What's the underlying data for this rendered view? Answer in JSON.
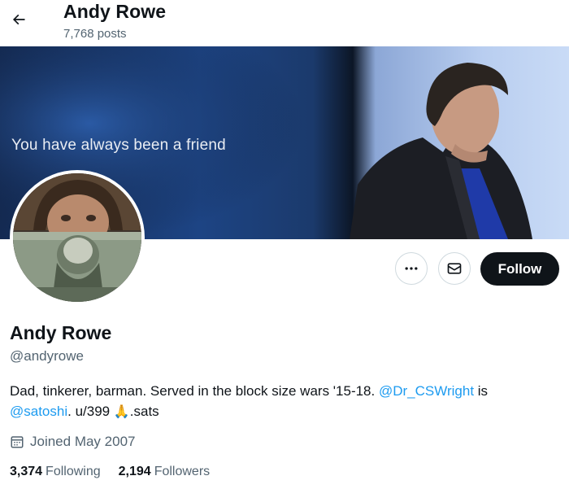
{
  "header": {
    "name": "Andy Rowe",
    "posts": "7,768 posts"
  },
  "banner": {
    "text": "You have always been a friend"
  },
  "actions": {
    "more_icon": "more-dots-icon",
    "message_icon": "envelope-icon",
    "follow_label": "Follow"
  },
  "profile": {
    "name": "Andy Rowe",
    "handle": "@andyrowe",
    "bio": {
      "text1": "Dad, tinkerer, barman.  Served in the block size wars '15-18.  ",
      "mention1": "@Dr_CSWright",
      "text2": " is",
      "mention2": "@satoshi",
      "text3": ".  u/399 ",
      "emoji": "🙏",
      "text4": ".sats"
    },
    "joined": "Joined May 2007",
    "following_count": "3,374",
    "following_label": "Following",
    "followers_count": "2,194",
    "followers_label": "Followers"
  },
  "colors": {
    "accent": "#1d9bf0",
    "text": "#0f1419",
    "muted": "#536471",
    "button": "#0f1419"
  }
}
